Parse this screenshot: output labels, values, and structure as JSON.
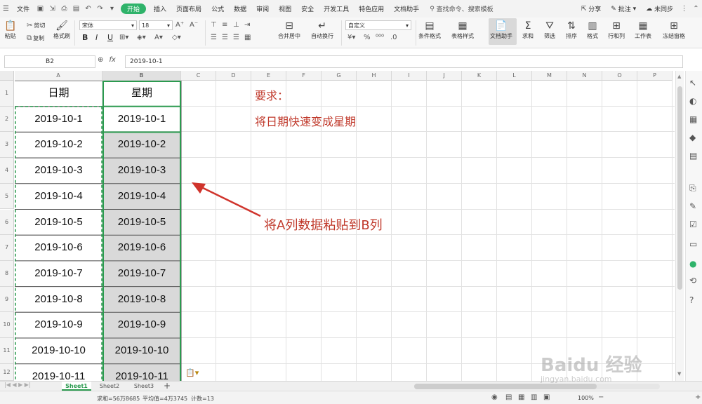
{
  "menubar": {
    "file": "文件",
    "tabs": [
      "开始",
      "插入",
      "页面布局",
      "公式",
      "数据",
      "审阅",
      "视图",
      "安全",
      "开发工具",
      "特色应用",
      "文档助手"
    ],
    "search": "查找命令、搜索模板",
    "share": "分享",
    "comment": "批注",
    "sync": "未同步"
  },
  "ribbon": {
    "paste": "粘贴",
    "cut": "剪切",
    "copy": "复制",
    "format_painter": "格式刷",
    "font_name": "宋体",
    "font_size": "18",
    "merge_center": "合并居中",
    "wrap_text": "自动换行",
    "number_format": "自定义",
    "percent": "%",
    "conditional_format": "条件格式",
    "table_style": "表格样式",
    "doc_assistant": "文档助手",
    "sum": "求和",
    "filter": "筛选",
    "sort": "排序",
    "format": "格式",
    "rows_cols": "行和列",
    "worksheet": "工作表",
    "freeze": "冻结窗格",
    "bold": "B",
    "italic": "I",
    "underline": "U"
  },
  "formula_bar": {
    "name_box": "B2",
    "fx_label": "fx",
    "value": "2019-10-1"
  },
  "columns": [
    "A",
    "B",
    "C",
    "D",
    "E",
    "F",
    "G",
    "H",
    "I",
    "J",
    "K",
    "L",
    "M",
    "N",
    "O",
    "P"
  ],
  "rows": [
    "1",
    "2",
    "3",
    "4",
    "5",
    "6",
    "7",
    "8",
    "9",
    "10",
    "11",
    "12"
  ],
  "sheet": {
    "header_A": "日期",
    "header_B": "星期",
    "dates": [
      "2019-10-1",
      "2019-10-2",
      "2019-10-3",
      "2019-10-4",
      "2019-10-5",
      "2019-10-6",
      "2019-10-7",
      "2019-10-8",
      "2019-10-9",
      "2019-10-10",
      "2019-10-11"
    ]
  },
  "notes": {
    "requirement_label": "要求：",
    "requirement_text": "将日期快速变成星期",
    "callout": "将A列数据粘贴到B列",
    "color": "#c0392b"
  },
  "sheet_tabs": [
    "Sheet1",
    "Sheet2",
    "Sheet3"
  ],
  "status": {
    "sum": "求和=56万8685",
    "average": "平均值=4万3745",
    "count": "计数=13",
    "zoom": "100%"
  },
  "watermark": {
    "brand": "Baidu 经验",
    "url": "jingyan.baidu.com"
  },
  "colors": {
    "accent": "#2fb36a",
    "selection_border": "#2b9a4f",
    "selected_fill": "#d9d9d9"
  }
}
